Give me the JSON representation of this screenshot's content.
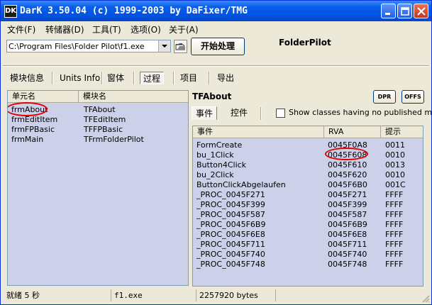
{
  "window": {
    "title": "DarK 3.50.04 (c) 1999-2003 by DaFixer/TMG",
    "app_icon": "DK"
  },
  "menu": [
    "文件(F)",
    "转储器(D)",
    "工具(T)",
    "选项(O)",
    "关于(A)"
  ],
  "toolbar": {
    "path": "C:\\Program Files\\Folder Pilot\\f1.exe",
    "start_label": "开始处理",
    "app_name": "FolderPilot"
  },
  "tabs": [
    "模块信息",
    "Units Info",
    "窗体",
    "过程",
    "项目",
    "导出"
  ],
  "active_tab": "过程",
  "left_list": {
    "headers": [
      "单元名",
      "模块名"
    ],
    "rows": [
      [
        "frmAbout",
        "TFAbout"
      ],
      [
        "frmEditItem",
        "TFEditItem"
      ],
      [
        "frmFPBasic",
        "TFFPBasic"
      ],
      [
        "frmMain",
        "TFrmFolderPilot"
      ]
    ]
  },
  "right": {
    "title": "TFAbout",
    "dpr_label": "DPR",
    "offs_label": "OFFS",
    "subtabs": [
      "事件",
      "控件"
    ],
    "checkbox_label": "Show classes having no published metho",
    "headers": [
      "事件",
      "RVA",
      "提示"
    ],
    "rows": [
      [
        "FormCreate",
        "0045F0A8",
        "0011"
      ],
      [
        "bu_1Click",
        "0045F608",
        "0010"
      ],
      [
        "Button4Click",
        "0045F610",
        "0013"
      ],
      [
        "bu_2Click",
        "0045F620",
        "0010"
      ],
      [
        "ButtonClickAbgelaufen",
        "0045F6B0",
        "001C"
      ],
      [
        "_PROC_0045F271",
        "0045F271",
        "FFFF"
      ],
      [
        "_PROC_0045F399",
        "0045F399",
        "FFFF"
      ],
      [
        "_PROC_0045F587",
        "0045F587",
        "FFFF"
      ],
      [
        "_PROC_0045F6B9",
        "0045F6B9",
        "FFFF"
      ],
      [
        "_PROC_0045F6E8",
        "0045F6E8",
        "FFFF"
      ],
      [
        "_PROC_0045F711",
        "0045F711",
        "FFFF"
      ],
      [
        "_PROC_0045F740",
        "0045F740",
        "FFFF"
      ],
      [
        "_PROC_0045F748",
        "0045F748",
        "FFFF"
      ]
    ]
  },
  "status": {
    "state": "就绪 5 秒",
    "file": "f1.exe",
    "size": "2257920 bytes"
  },
  "colors": {
    "list_bg": "#ccd0e8",
    "highlight_ring": "#e60000",
    "titlebar": "#0054e3"
  }
}
